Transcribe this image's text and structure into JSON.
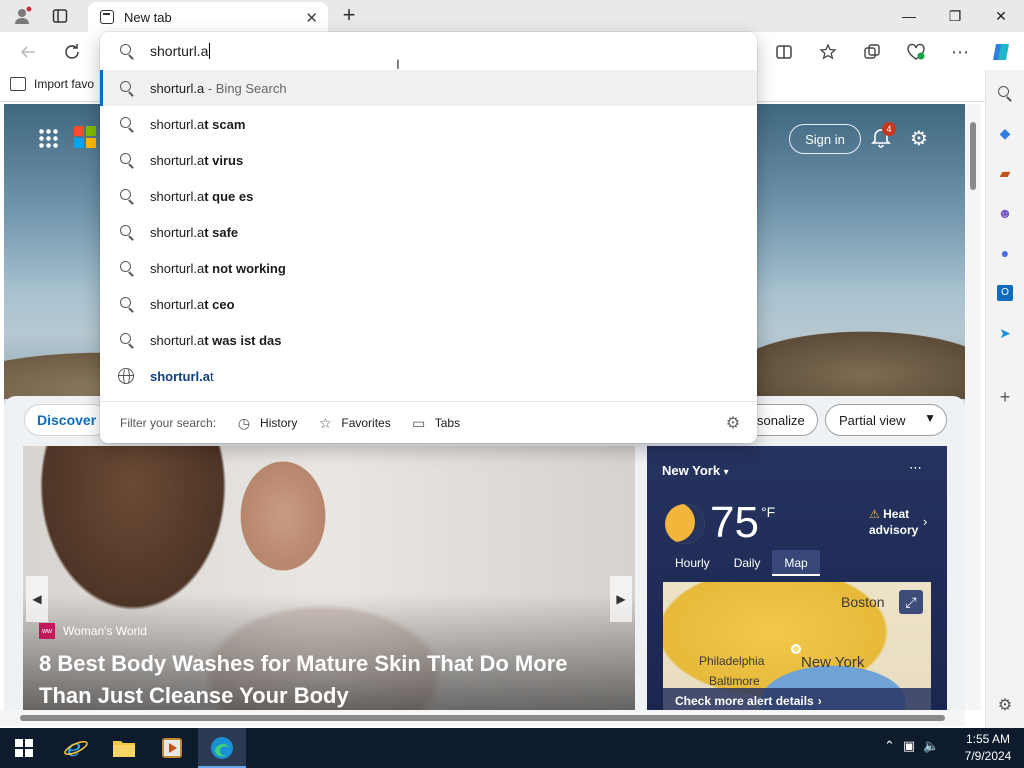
{
  "window": {
    "tab_title": "New tab",
    "new_tab_glyph": "+",
    "minimize_glyph": "—",
    "restore_glyph": "❐",
    "close_glyph": "✕"
  },
  "favorites_bar": {
    "import_label": "Import favo"
  },
  "omnibox": {
    "typed_text": "shorturl.a",
    "suggestions": [
      {
        "type": "search",
        "prefix": "shorturl.a",
        "bold": "",
        "sub": " - Bing Search",
        "active": true
      },
      {
        "type": "search",
        "prefix": "shorturl.a",
        "bold": "t scam"
      },
      {
        "type": "search",
        "prefix": "shorturl.a",
        "bold": "t virus"
      },
      {
        "type": "search",
        "prefix": "shorturl.a",
        "bold": "t que es"
      },
      {
        "type": "search",
        "prefix": "shorturl.a",
        "bold": "t safe"
      },
      {
        "type": "search",
        "prefix": "shorturl.a",
        "bold": "t not working"
      },
      {
        "type": "search",
        "prefix": "shorturl.a",
        "bold": "t ceo"
      },
      {
        "type": "search",
        "prefix": "shorturl.a",
        "bold": "t was ist das"
      },
      {
        "type": "url",
        "prefix": "shorturl.a",
        "bold": "t"
      }
    ],
    "filter_label": "Filter your search:",
    "filters": [
      "History",
      "Favorites",
      "Tabs"
    ]
  },
  "page": {
    "signin_label": "Sign in",
    "notification_count": "4",
    "discover_label": "Discover",
    "personalize_label": "sonalize",
    "partial_view_label": "Partial view",
    "news": {
      "source": "Woman's World",
      "source_logo": "ww",
      "headline": "8 Best Body Washes for Mature Skin That Do More Than Just Cleanse Your Body"
    },
    "weather": {
      "city": "New York",
      "temp": "75",
      "unit": "°F",
      "alert": "Heat advisory",
      "tabs": [
        "Hourly",
        "Daily",
        "Map"
      ],
      "active_tab": "Map",
      "map_labels": [
        "Boston",
        "Philadelphia",
        "New York",
        "Baltimore"
      ],
      "footer": "Check more alert details"
    }
  },
  "taskbar": {
    "time": "1:55 AM",
    "date": "7/9/2024"
  }
}
